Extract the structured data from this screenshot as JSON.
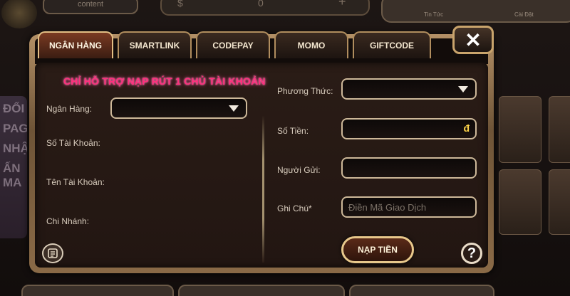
{
  "background": {
    "top_left_label": "content",
    "coin_amount": "0",
    "coin_symbol": "$",
    "plus_symbol": "+",
    "right_bar_items": [
      "Tin Tức",
      "Cài Đặt"
    ],
    "left_banner_text": [
      "ĐỔI",
      "PAGI",
      "NHẬT",
      "ẤN MA"
    ]
  },
  "dialog": {
    "tabs": [
      {
        "label": "NGÂN HÀNG",
        "active": true
      },
      {
        "label": "SMARTLINK",
        "active": false
      },
      {
        "label": "CODEPAY",
        "active": false
      },
      {
        "label": "MOMO",
        "active": false
      },
      {
        "label": "GIFTCODE",
        "active": false
      }
    ],
    "close_symbol": "✕",
    "notice": "CHỈ HỖ TRỢ NẠP RÚT 1 CHỦ TÀI KHOẢN",
    "left_form": {
      "bank_label": "Ngân Hàng:",
      "bank_value": "",
      "account_number_label": "Số Tài Khoản:",
      "account_name_label": "Tên Tài Khoản:",
      "branch_label": "Chi Nhánh:"
    },
    "right_form": {
      "method_label": "Phương Thức:",
      "method_value": "",
      "amount_label": "Số Tiền:",
      "amount_value": "",
      "currency_symbol": "đ",
      "sender_label": "Người Gửi:",
      "sender_value": "",
      "note_label": "Ghi Chú*",
      "note_placeholder": "Điền Mã Giao Dịch"
    },
    "submit_label": "NẠP TIỀN",
    "help_symbol": "?",
    "icons": {
      "close": "close-icon",
      "dropdown": "chevron-down-icon",
      "help": "help-icon",
      "history": "history-icon"
    }
  },
  "colors": {
    "notice": "#ff2e7d",
    "frame_gold": "#c9a46c",
    "panel": "#221612",
    "currency": "#ffd64a"
  }
}
